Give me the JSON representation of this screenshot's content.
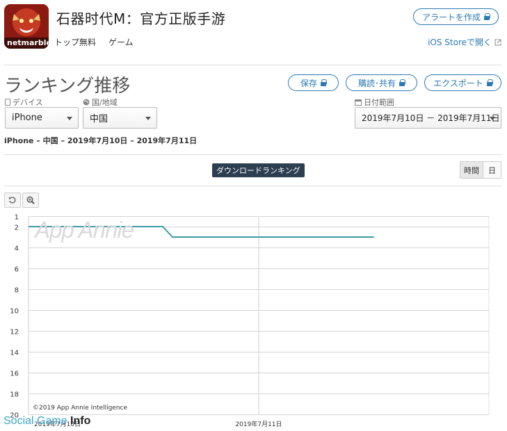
{
  "app": {
    "title": "石器时代M：官方正版手游",
    "publisher_logo_text": "netmarble",
    "price_label": "トップ無料",
    "category_label": "ゲーム"
  },
  "header_actions": {
    "alert_button": "アラートを作成",
    "store_link": "iOS Storeで開く"
  },
  "page": {
    "heading": "ランキング推移",
    "actions": {
      "save": "保存",
      "subscribe": "購読･共有",
      "export": "エクスポート"
    }
  },
  "filters": {
    "device": {
      "label": "デバイス",
      "value": "iPhone"
    },
    "country": {
      "label": "国/地域",
      "value": "中国"
    },
    "date_range": {
      "label": "日付範囲",
      "value": "2019年7月10日 － 2019年7月11日"
    }
  },
  "context_line": "iPhone – 中国 – 2019年7月10日 – 2019年7月11日",
  "tabs": {
    "active": "ダウンロードランキング"
  },
  "granularity": {
    "hour": "時間",
    "day": "日"
  },
  "watermarks": {
    "chart": "App Annie",
    "copyright": "©2019 App Annie Intelligence",
    "source_a": "Social Game",
    "source_b": "Info"
  },
  "colors": {
    "accent": "#2b7ab4",
    "series_line": "#3a9aa6",
    "tab_badge": "#2c3e50"
  },
  "chart_data": {
    "type": "line",
    "y_reversed": true,
    "ylim": [
      1,
      20
    ],
    "yticks": [
      "1",
      "2",
      "4",
      "6",
      "8",
      "10",
      "12",
      "14",
      "16",
      "18",
      "20"
    ],
    "xticks": [
      "2019年7月10日",
      "2019年7月11日"
    ],
    "series": [
      {
        "x": [
          "2019-07-10 00:00",
          "2019-07-10 14:00",
          "2019-07-10 15:00",
          "2019-07-11 00:00",
          "2019-07-11 12:00"
        ],
        "values": [
          2,
          2,
          3,
          3,
          3
        ]
      }
    ]
  }
}
